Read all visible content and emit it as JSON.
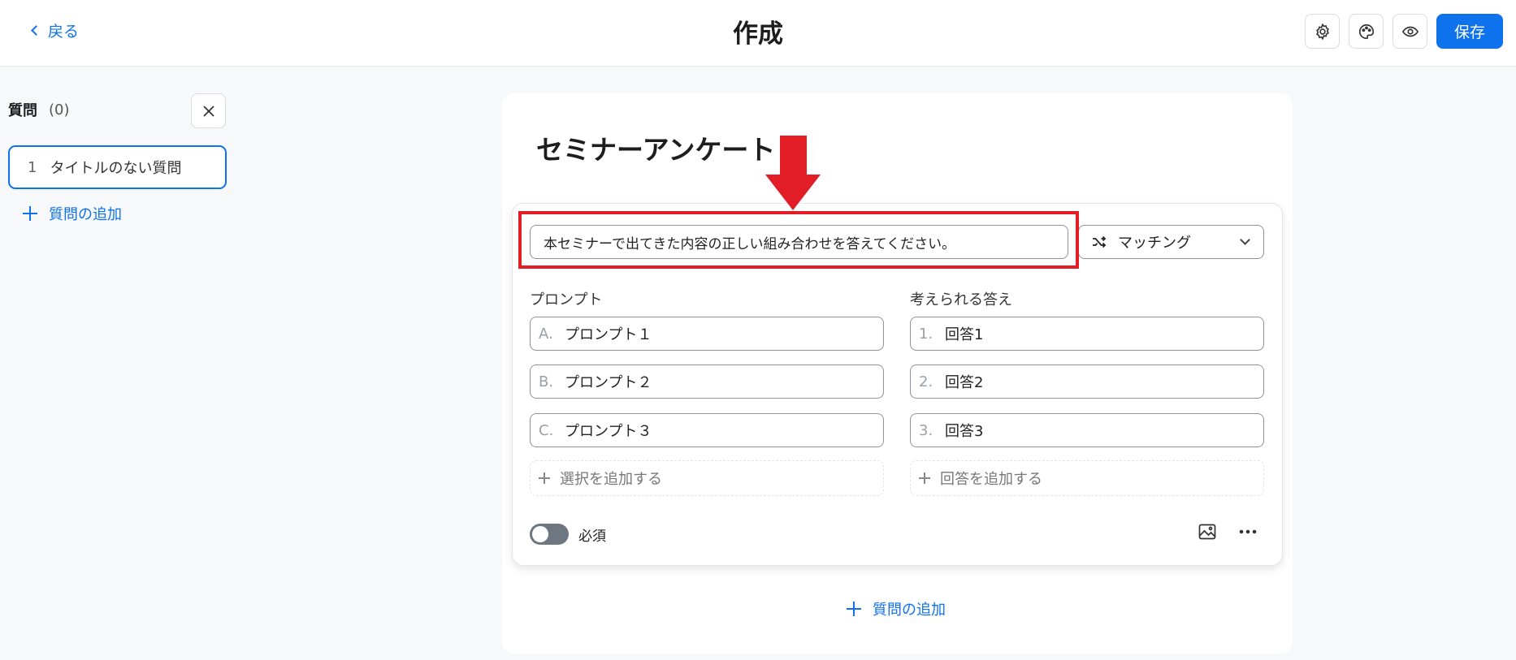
{
  "header": {
    "back_label": "戻る",
    "title": "作成",
    "save_label": "保存",
    "icons": [
      "gear-icon",
      "palette-icon",
      "eye-icon"
    ]
  },
  "sidebar": {
    "title": "質問",
    "count": "(0)",
    "items": [
      {
        "number": "1",
        "label": "タイトルのない質問"
      }
    ],
    "add_label": "質問の追加"
  },
  "survey": {
    "title": "セミナーアンケート"
  },
  "question": {
    "text": "本セミナーで出てきた内容の正しい組み合わせを答えてください。",
    "type_label": "マッチング",
    "prompts_header": "プロンプト",
    "answers_header": "考えられる答え",
    "prompts": [
      {
        "label": "A.",
        "value": "プロンプト１"
      },
      {
        "label": "B.",
        "value": "プロンプト２"
      },
      {
        "label": "C.",
        "value": "プロンプト３"
      }
    ],
    "answers": [
      {
        "label": "1.",
        "value": "回答1"
      },
      {
        "label": "2.",
        "value": "回答2"
      },
      {
        "label": "3.",
        "value": "回答3"
      }
    ],
    "add_prompt_label": "選択を追加する",
    "add_answer_label": "回答を追加する",
    "required_label": "必須",
    "required_on": false
  },
  "bottom_add_label": "質問の追加",
  "colors": {
    "accent": "#0e72ed",
    "annotation": "#e31d25"
  }
}
